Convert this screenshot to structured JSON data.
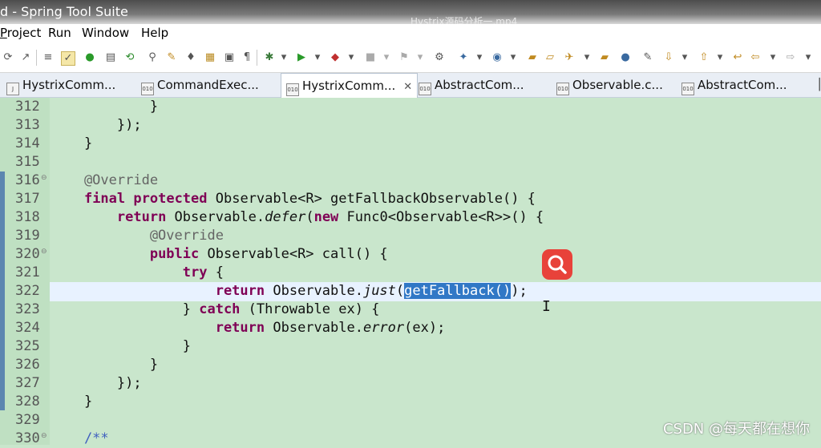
{
  "window": {
    "title": "d - Spring Tool Suite",
    "video_name": "Hystrix源码分析一.mp4"
  },
  "menu": [
    "roject",
    "Run",
    "Window",
    "Help"
  ],
  "menu_prefix": "P",
  "tabs": [
    {
      "label": "HystrixComm...",
      "icon": "java-file-icon",
      "active": false
    },
    {
      "label": "CommandExec...",
      "icon": "class-file-icon",
      "active": false
    },
    {
      "label": "HystrixComm...",
      "icon": "class-file-icon",
      "active": true
    },
    {
      "label": "AbstractCom...",
      "icon": "class-file-icon",
      "active": false
    },
    {
      "label": "Observable.c...",
      "icon": "class-file-icon",
      "active": false
    },
    {
      "label": "AbstractCom...",
      "icon": "class-file-icon",
      "active": false
    }
  ],
  "code_lines": [
    {
      "n": "312",
      "text": "            }"
    },
    {
      "n": "313",
      "text": "        });"
    },
    {
      "n": "314",
      "text": "    }"
    },
    {
      "n": "315",
      "text": ""
    },
    {
      "n": "316",
      "text": "    @Override"
    },
    {
      "n": "317",
      "text": "    final protected Observable<R> getFallbackObservable() {"
    },
    {
      "n": "318",
      "text": "        return Observable.defer(new Func0<Observable<R>>() {"
    },
    {
      "n": "319",
      "text": "            @Override"
    },
    {
      "n": "320",
      "text": "            public Observable<R> call() {"
    },
    {
      "n": "321",
      "text": "                try {"
    },
    {
      "n": "322",
      "text": "                    return Observable.just(getFallback());"
    },
    {
      "n": "323",
      "text": "                } catch (Throwable ex) {"
    },
    {
      "n": "324",
      "text": "                    return Observable.error(ex);"
    },
    {
      "n": "325",
      "text": "                }"
    },
    {
      "n": "326",
      "text": "            }"
    },
    {
      "n": "327",
      "text": "        });"
    },
    {
      "n": "328",
      "text": "    }"
    },
    {
      "n": "329",
      "text": ""
    },
    {
      "n": "330",
      "text": "    /**"
    }
  ],
  "selection": "getFallback()",
  "watermark": "CSDN @每天都在想你",
  "colors": {
    "keyword": "#7f0055",
    "annotation": "#646464",
    "comment": "#3f5fbf",
    "selection": "#3178c6",
    "editor_bg": "#c9e6cc"
  }
}
